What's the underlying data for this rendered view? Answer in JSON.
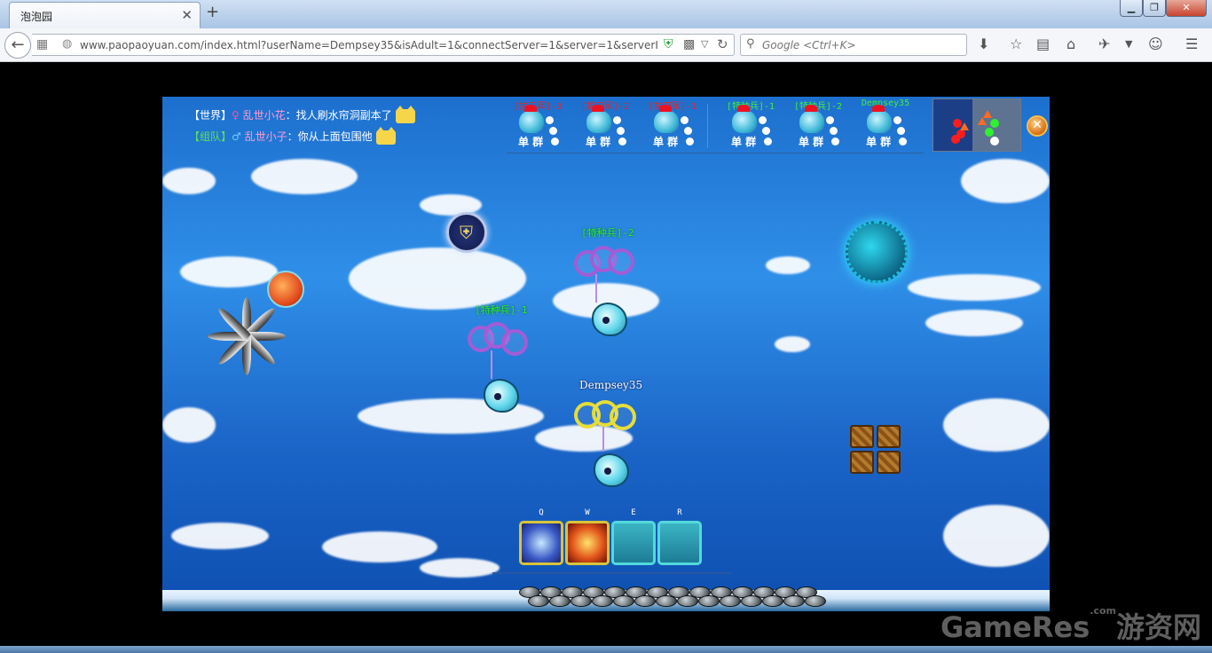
{
  "browser": {
    "tab_title": "泡泡园",
    "url": "www.paopaoyuan.com/index.html?userName=Dempsey35&isAdult=1&connectServer=1&server=1&serverIp=19",
    "search_placeholder": "Google <Ctrl+K>",
    "icons": [
      "back-arrow-icon",
      "page-info-icon",
      "globe-icon",
      "shield-icon",
      "qr-code-icon",
      "dropdown-icon",
      "reload-icon",
      "search-icon",
      "download-icon",
      "bookmark-star-icon",
      "reading-list-icon",
      "home-icon",
      "tools-icon",
      "menu-icon"
    ]
  },
  "chat": {
    "lines": [
      {
        "channel": "【世界】",
        "gender": "♀",
        "speaker": "乱世小花",
        "text": "找人刷水帘洞副本了"
      },
      {
        "channel": "【组队】",
        "gender": "♂",
        "speaker": "乱世小子",
        "text": "你从上面包围他"
      }
    ]
  },
  "scoreboard": {
    "mode_labels": "单 群",
    "red_team": [
      "[护卫军]-3",
      "[护卫军]-2",
      "[护卫军]-1"
    ],
    "green_team": [
      "[特种兵]-1",
      "[特种兵]-2",
      "Dempsey35"
    ]
  },
  "units": [
    {
      "name": "[特种兵]-2",
      "team": "green"
    },
    {
      "name": "[特种兵]-1",
      "team": "green"
    },
    {
      "name": "Dempsey35",
      "team": "self"
    }
  ],
  "skills": [
    {
      "key": "Q",
      "state": "active",
      "icon": "lightning-skill-icon"
    },
    {
      "key": "W",
      "state": "active",
      "icon": "fire-skill-icon"
    },
    {
      "key": "E",
      "state": "empty"
    },
    {
      "key": "R",
      "state": "empty"
    }
  ],
  "close_label": "✕",
  "watermark": {
    "text": "GameRes",
    "sub": ".com",
    "cn": "游资网"
  },
  "colors": {
    "red_team": "#e62323",
    "green_team": "#3ff03a",
    "sky": "#2f8fe8"
  }
}
